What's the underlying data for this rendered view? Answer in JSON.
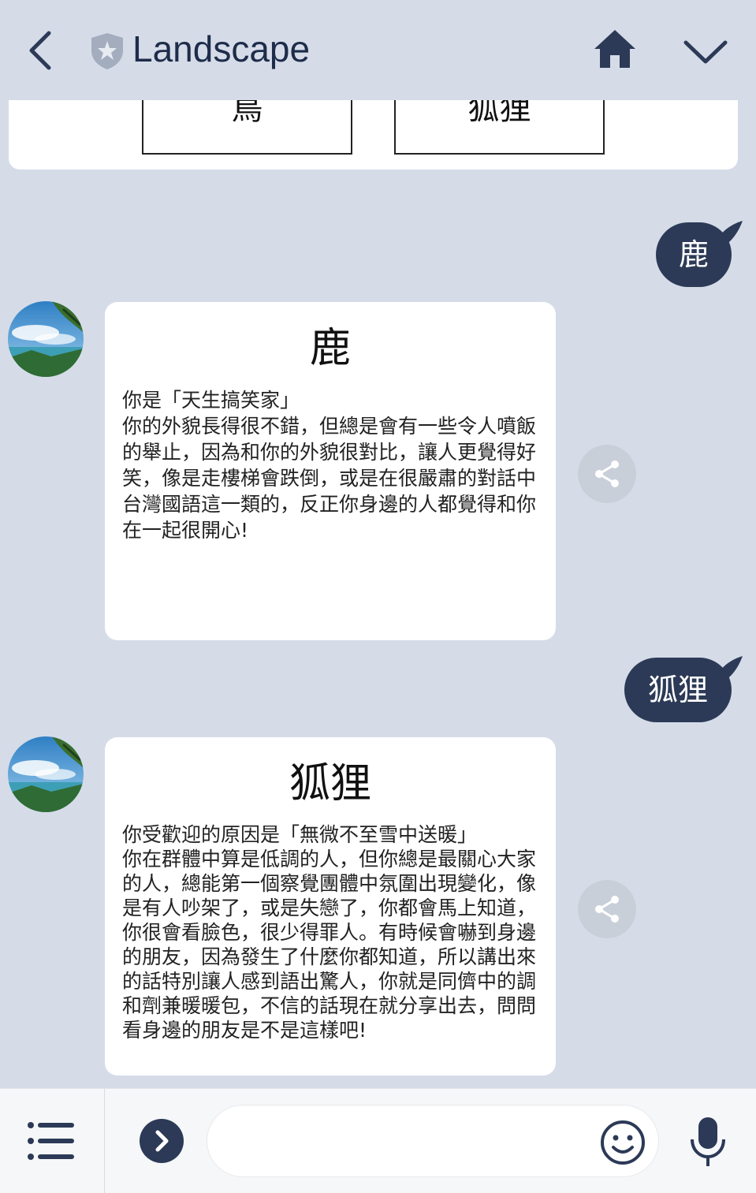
{
  "header": {
    "title": "Landscape",
    "icons": [
      "back-arrow-icon",
      "shield-star-icon",
      "home-icon",
      "chevron-down-icon"
    ]
  },
  "top_card": {
    "options": [
      "鳥",
      "狐狸"
    ]
  },
  "messages": [
    {
      "from": "user",
      "text": "鹿"
    },
    {
      "from": "bot",
      "title": "鹿",
      "body": "你是「天生搞笑家」\n你的外貌長得很不錯，但總是會有一些令人噴飯的舉止，因為和你的外貌很對比，讓人更覺得好笑，像是走樓梯會跌倒，或是在很嚴肅的對話中台灣國語這一類的，反正你身邊的人都覺得和你在一起很開心!"
    },
    {
      "from": "user",
      "text": "狐狸"
    },
    {
      "from": "bot",
      "title": "狐狸",
      "body": "你受歡迎的原因是「無微不至雪中送暖」\n你在群體中算是低調的人，但你總是最關心大家的人，總能第一個察覺團體中氛圍出現變化，像是有人吵架了，或是失戀了，你都會馬上知道，你很會看臉色，很少得罪人。有時候會嚇到身邊的朋友，因為發生了什麼你都知道，所以講出來的話特別讓人感到語出驚人，你就是同儕中的調和劑兼暖暖包，不信的話現在就分享出去，問問看身邊的朋友是不是這樣吧!"
    }
  ],
  "footer": {
    "icons": [
      "menu-icon",
      "expand-arrow-icon",
      "emoji-icon",
      "microphone-icon"
    ],
    "input_value": ""
  },
  "colors": {
    "background": "#d5dce8",
    "bubble": "#2c3a57",
    "text_dark": "#1e2c4a"
  }
}
